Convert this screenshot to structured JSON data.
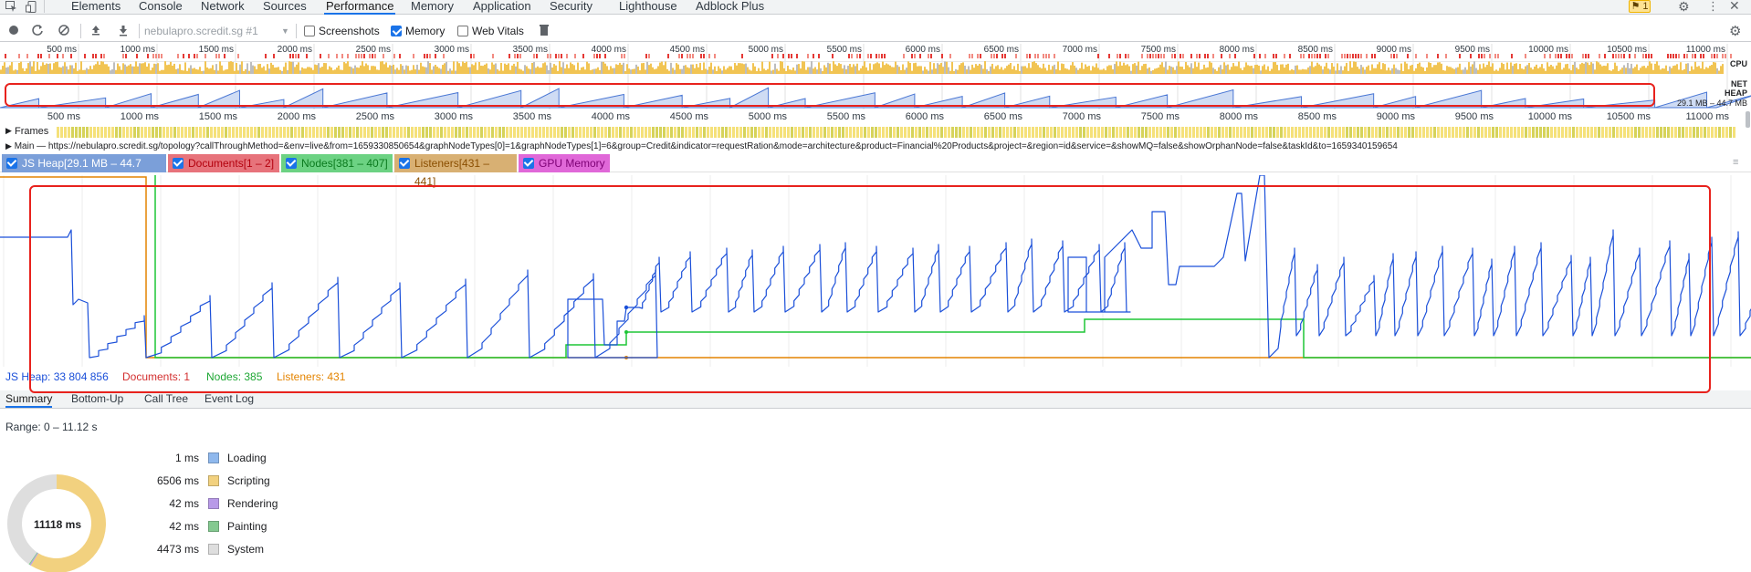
{
  "tabs": [
    "Elements",
    "Console",
    "Network",
    "Sources",
    "Performance",
    "Memory",
    "Application",
    "Security",
    "Lighthouse",
    "Adblock Plus"
  ],
  "active_tab": "Performance",
  "issues_badge": "1",
  "toolbar": {
    "recording_select": "nebulapro.scredit.sg #1",
    "screenshots_label": "Screenshots",
    "memory_label": "Memory",
    "web_vitals_label": "Web Vitals"
  },
  "overview": {
    "ticks": [
      "500 ms",
      "1000 ms",
      "1500 ms",
      "2000 ms",
      "2500 ms",
      "3000 ms",
      "3500 ms",
      "4000 ms",
      "4500 ms",
      "5000 ms",
      "5500 ms",
      "6000 ms",
      "6500 ms",
      "7000 ms",
      "7500 ms",
      "8000 ms",
      "8500 ms",
      "9000 ms",
      "9500 ms",
      "10000 ms",
      "10500 ms",
      "11000 ms"
    ],
    "cpu_label": "CPU",
    "net_label": "NET",
    "heap_label": "HEAP",
    "heap_range": "29.1 MB – 44.7 MB"
  },
  "main_ruler": {
    "ticks": [
      "500 ms",
      "1000 ms",
      "1500 ms",
      "2000 ms",
      "2500 ms",
      "3000 ms",
      "3500 ms",
      "4000 ms",
      "4500 ms",
      "5000 ms",
      "5500 ms",
      "6000 ms",
      "6500 ms",
      "7000 ms",
      "7500 ms",
      "8000 ms",
      "8500 ms",
      "9000 ms",
      "9500 ms",
      "10000 ms",
      "10500 ms",
      "11000 ms"
    ]
  },
  "frames_label": "Frames",
  "main_row": "Main — https://nebulapro.scredit.sg/topology?callThroughMethod=&env=live&from=1659330850654&graphNodeTypes[0]=1&graphNodeTypes[1]=6&group=Credit&indicator=requestRation&mode=architecture&product=Financial%20Products&project=&region=id&service=&showMQ=false&showOrphanNode=false&taskId&to=1659340159654",
  "counters": {
    "js_heap": "JS Heap[29.1 MB – 44.7 MB]",
    "documents": "Documents[1 – 2]",
    "nodes": "Nodes[381 – 407]",
    "listeners": "Listeners[431 – 441]",
    "gpu_memory": "GPU Memory"
  },
  "counter_colors": {
    "js_heap": "#7b9fd9",
    "documents": "#e7737b",
    "nodes": "#6cd283",
    "listeners": "#d8b073",
    "gpu_memory": "#e068d8"
  },
  "memory_footer": {
    "js_heap": "JS Heap: 33 804 856",
    "documents": "Documents: 1",
    "nodes": "Nodes: 385",
    "listeners": "Listeners: 431"
  },
  "bottom_tabs": [
    "Summary",
    "Bottom-Up",
    "Call Tree",
    "Event Log"
  ],
  "range": "Range: 0 – 11.12 s",
  "summary": [
    {
      "ms": "1 ms",
      "label": "Loading",
      "color": "#8fb8ed"
    },
    {
      "ms": "6506 ms",
      "label": "Scripting",
      "color": "#f2d17f"
    },
    {
      "ms": "42 ms",
      "label": "Rendering",
      "color": "#b89ae8"
    },
    {
      "ms": "42 ms",
      "label": "Painting",
      "color": "#84c990"
    },
    {
      "ms": "4473 ms",
      "label": "System",
      "color": "#dedede"
    }
  ],
  "donut_total": "11118 ms",
  "chart_data": {
    "type": "line",
    "title": "",
    "x_range_ms": [
      0,
      11120
    ],
    "js_heap_range_mb": [
      29.1,
      44.7
    ],
    "series": [
      {
        "name": "JS Heap",
        "color": "#1a4fd9",
        "description": "sawtooth between ~29 and ~45 MB"
      },
      {
        "name": "Documents",
        "values": [
          1,
          2
        ],
        "color": "#d32f2f"
      },
      {
        "name": "Nodes",
        "values": [
          381,
          407
        ],
        "color": "#1ec636"
      },
      {
        "name": "Listeners",
        "values": [
          431,
          441
        ],
        "color": "#e48400"
      }
    ]
  }
}
